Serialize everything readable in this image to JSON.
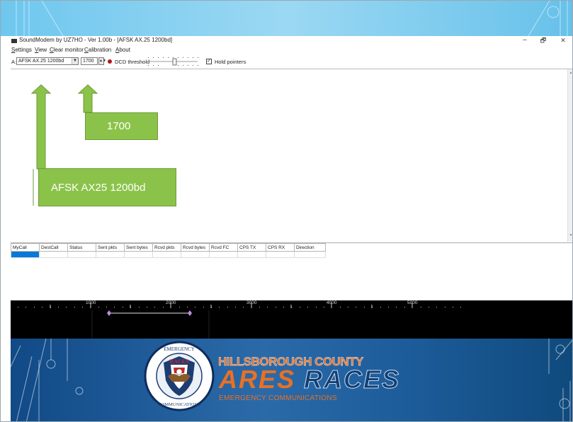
{
  "window": {
    "title": "SoundModem by UZ7HO - Ver 1.00b - [AFSK AX.25 1200bd]",
    "minimize": "–",
    "maximize": "🗗",
    "close": "✕"
  },
  "menu": [
    "Settings",
    "View",
    "Clear monitor",
    "Calibration",
    "About"
  ],
  "toolbar": {
    "modem_label": "A:",
    "mode_value": "AFSK AX.25 1200bd",
    "freq_value": "1700",
    "dcd_label": "DCD threshold",
    "hold_label": "Hold pointers",
    "hold_checked": "✓"
  },
  "table": {
    "columns": [
      "MyCall",
      "DestCall",
      "Status",
      "Sent pkts",
      "Sent bytes",
      "Rcvd pkts",
      "Rcvd bytes",
      "Rcvd FC",
      "CPS TX",
      "CPS RX",
      "Direction"
    ]
  },
  "spectrum": {
    "freq_labels": [
      "1000",
      "2000",
      "3000",
      "4000",
      "5000"
    ]
  },
  "annotations": {
    "freq_callout": "1700",
    "mode_callout": "AFSK AX25 1200bd"
  },
  "branding": {
    "org_line": "HILLSBOROUGH COUNTY",
    "ares": "ARES",
    "races": "RACES",
    "tagline": "EMERGENCY COMMUNICATIONS",
    "seal_top": "EMERGENCY",
    "seal_races": "RACES",
    "seal_bottom": "COMMUNICATIONS"
  },
  "colors": {
    "callout": "#8bc34a",
    "banner_top": "#6ec7ee",
    "banner_bottom": "#1d5c9b",
    "brand_orange": "#e87124",
    "selection": "#0a78d7"
  }
}
